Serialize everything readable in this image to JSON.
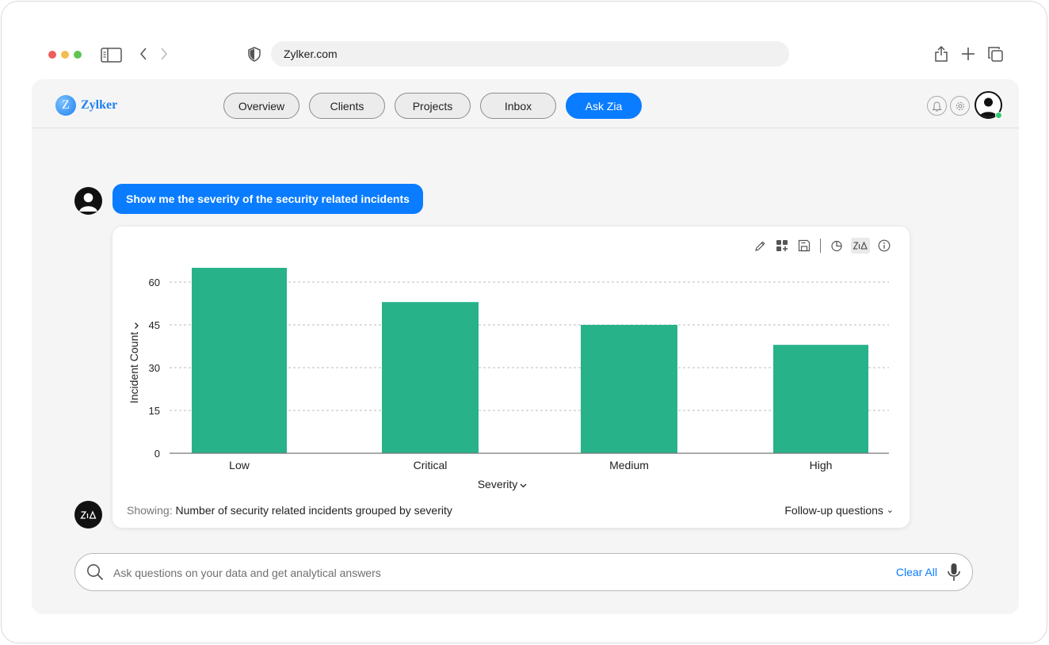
{
  "browser": {
    "url": "Zylker.com",
    "traffic_colors": [
      "#ec5f5a",
      "#f4bd4f",
      "#5fc453"
    ]
  },
  "app": {
    "logo_letter": "Z",
    "logo_text": "Zylker",
    "nav": [
      {
        "label": "Overview",
        "active": false
      },
      {
        "label": "Clients",
        "active": false
      },
      {
        "label": "Projects",
        "active": false
      },
      {
        "label": "Inbox",
        "active": false
      },
      {
        "label": "Ask Zia",
        "active": true
      }
    ],
    "accent": "#0a7cff"
  },
  "chat": {
    "user_question": "Show me the severity of the security related incidents",
    "footer_prefix": "Showing:",
    "footer_text": "Number of security related incidents grouped by severity",
    "followup_label": "Follow-up questions",
    "followup_caret": "⌄"
  },
  "chart_data": {
    "type": "bar",
    "categories": [
      "Low",
      "Critical",
      "Medium",
      "High"
    ],
    "values": [
      65,
      53,
      45,
      38
    ],
    "xlabel": "Severity",
    "ylabel": "Incident Count",
    "ylim": [
      0,
      60
    ],
    "yticks": [
      0,
      15,
      30,
      45,
      60
    ],
    "bar_color": "#27b28a",
    "grid": true
  },
  "query": {
    "placeholder": "Ask questions on your data and get analytical answers",
    "clear_label": "Clear All"
  }
}
